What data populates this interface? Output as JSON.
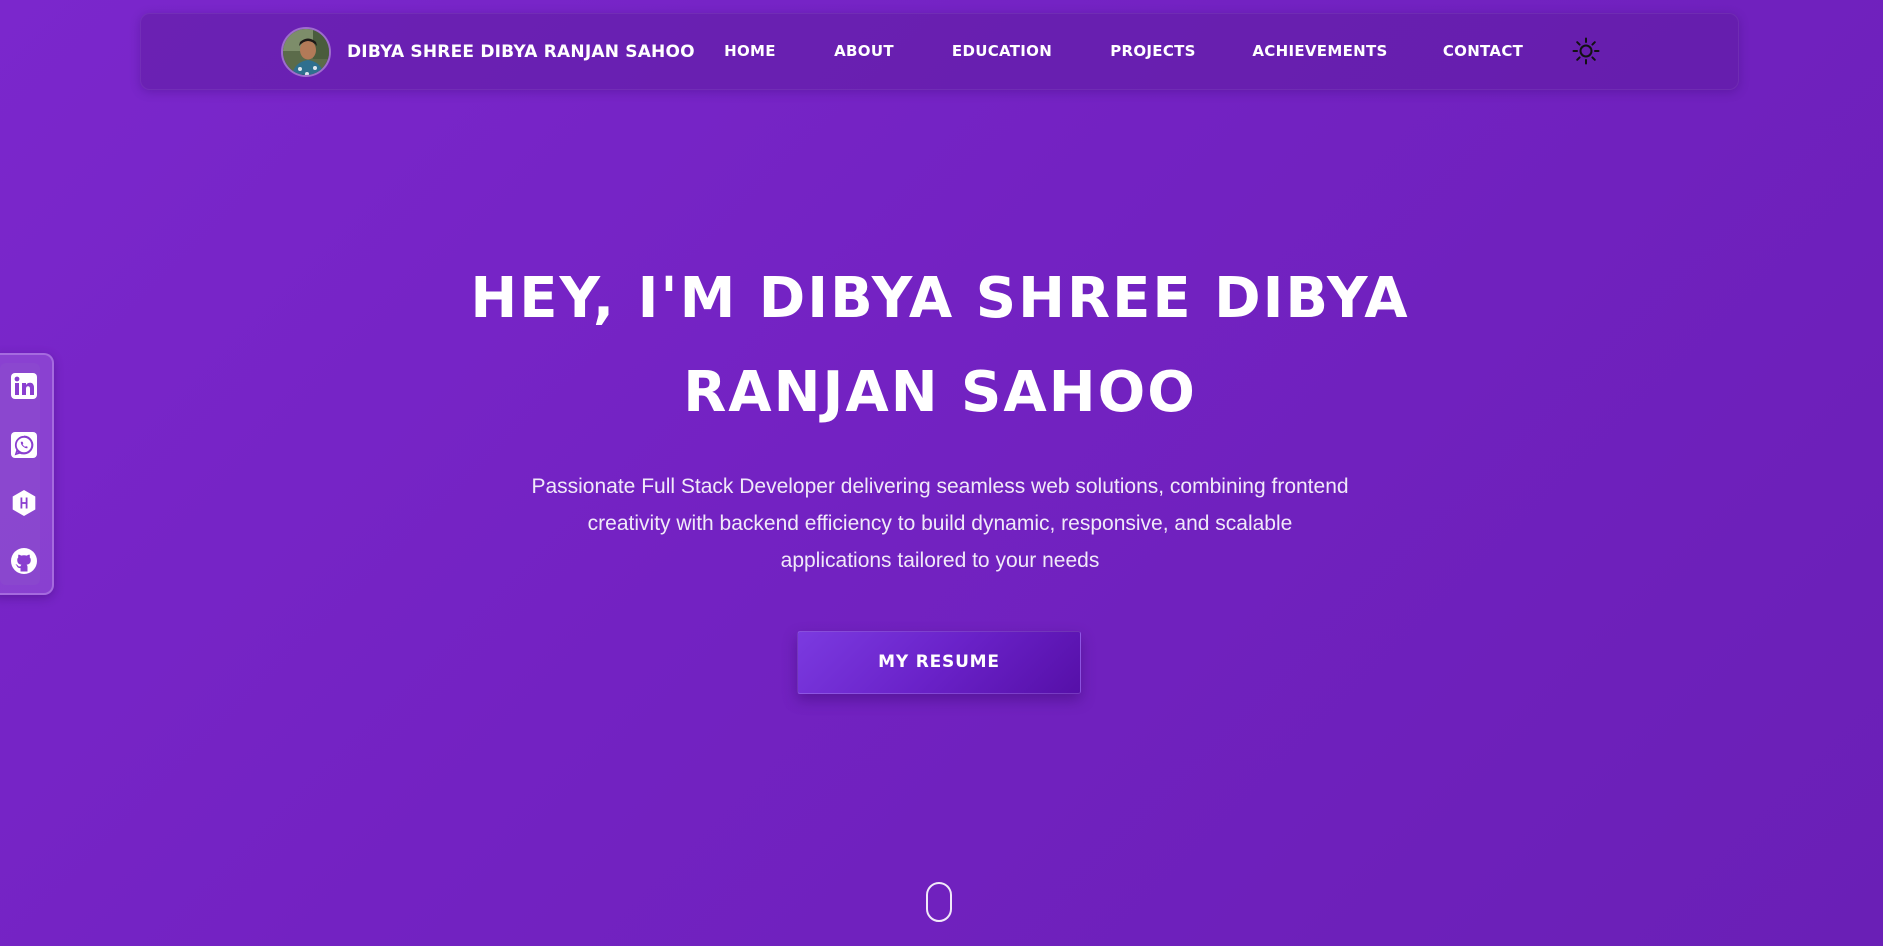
{
  "navbar": {
    "brand_name": "DIBYA SHREE DIBYA RANJAN SAHOO",
    "links": [
      {
        "label": "HOME"
      },
      {
        "label": "ABOUT"
      },
      {
        "label": "EDUCATION"
      },
      {
        "label": "PROJECTS"
      },
      {
        "label": "ACHIEVEMENTS"
      },
      {
        "label": "CONTACT"
      }
    ],
    "theme_toggle_icon": "sun-icon"
  },
  "social": [
    {
      "icon": "linkedin-icon"
    },
    {
      "icon": "whatsapp-icon"
    },
    {
      "icon": "hashnode-icon"
    },
    {
      "icon": "github-icon"
    }
  ],
  "hero": {
    "title_line1": "HEY, I'M DIBYA SHREE DIBYA",
    "title_line2": "RANJAN SAHOO",
    "description_line1": "Passionate Full Stack Developer delivering seamless web solutions, combining frontend",
    "description_line2": "creativity with backend efficiency to build dynamic, responsive, and scalable",
    "description_line3": "applications tailored to your needs",
    "resume_button": "MY RESUME"
  },
  "colors": {
    "background": "#7322c2",
    "navbar": "#5f1ea0",
    "button": "#6a22c9",
    "text": "#ffffff"
  }
}
